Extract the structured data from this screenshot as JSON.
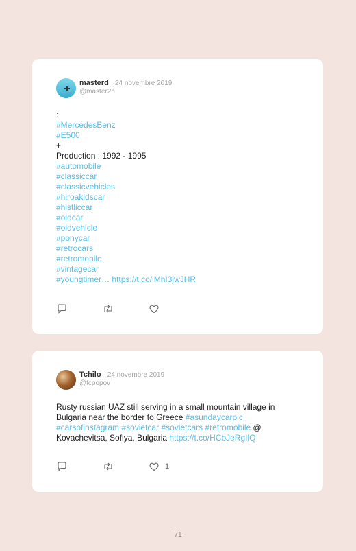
{
  "tweets": [
    {
      "username": "masterd",
      "date": "· 24 novembre 2019",
      "handle": "@master2h",
      "lines": [
        [
          {
            "t": "text",
            "v": ":"
          }
        ],
        [
          {
            "t": "tag",
            "v": "#MercedesBenz"
          }
        ],
        [
          {
            "t": "tag",
            "v": "#E500"
          }
        ],
        [
          {
            "t": "text",
            "v": "+"
          }
        ],
        [
          {
            "t": "text",
            "v": "Production : 1992 - 1995"
          }
        ],
        [
          {
            "t": "tag",
            "v": "#automobile"
          }
        ],
        [
          {
            "t": "tag",
            "v": "#classiccar"
          }
        ],
        [
          {
            "t": "tag",
            "v": "#classicvehicles"
          }
        ],
        [
          {
            "t": "tag",
            "v": "#hiroakidscar"
          }
        ],
        [
          {
            "t": "tag",
            "v": "#histliccar"
          }
        ],
        [
          {
            "t": "tag",
            "v": "#oldcar"
          }
        ],
        [
          {
            "t": "tag",
            "v": "#oldvehicle"
          }
        ],
        [
          {
            "t": "tag",
            "v": "#ponycar"
          }
        ],
        [
          {
            "t": "tag",
            "v": "#retrocars"
          }
        ],
        [
          {
            "t": "tag",
            "v": "#retromobile"
          }
        ],
        [
          {
            "t": "tag",
            "v": "#vintagecar"
          }
        ],
        [
          {
            "t": "tag",
            "v": "#youngtimer…"
          },
          {
            "t": "text",
            "v": " "
          },
          {
            "t": "link",
            "v": "https://t.co/lMhI3jwJHR"
          }
        ]
      ],
      "like_count": ""
    },
    {
      "username": "Tchilo",
      "date": "· 24 novembre 2019",
      "handle": "@tcpopov",
      "lines": [
        [
          {
            "t": "text",
            "v": "Rusty russian UAZ still serving in a small mountain village in"
          }
        ],
        [
          {
            "t": "text",
            "v": "Bulgaria near the border to Greece "
          },
          {
            "t": "tag",
            "v": "#asundaycarpic"
          }
        ],
        [
          {
            "t": "tag",
            "v": "#carsofinstagram"
          },
          {
            "t": "text",
            "v": " "
          },
          {
            "t": "tag",
            "v": "#sovietcar"
          },
          {
            "t": "text",
            "v": " "
          },
          {
            "t": "tag",
            "v": "#sovietcars"
          },
          {
            "t": "text",
            "v": " "
          },
          {
            "t": "tag",
            "v": "#retromobile"
          },
          {
            "t": "text",
            "v": " @"
          }
        ],
        [
          {
            "t": "text",
            "v": "Kovachevitsa, Sofiya, Bulgaria "
          },
          {
            "t": "link",
            "v": "https://t.co/HCbJeRgIlQ"
          }
        ]
      ],
      "like_count": "1"
    }
  ],
  "page_number": "71",
  "icons": {
    "reply": "reply-icon",
    "retweet": "retweet-icon",
    "like": "heart-icon"
  },
  "colors": {
    "accent": "#5dbde2",
    "background": "#f3e4e0",
    "card": "#ffffff"
  }
}
